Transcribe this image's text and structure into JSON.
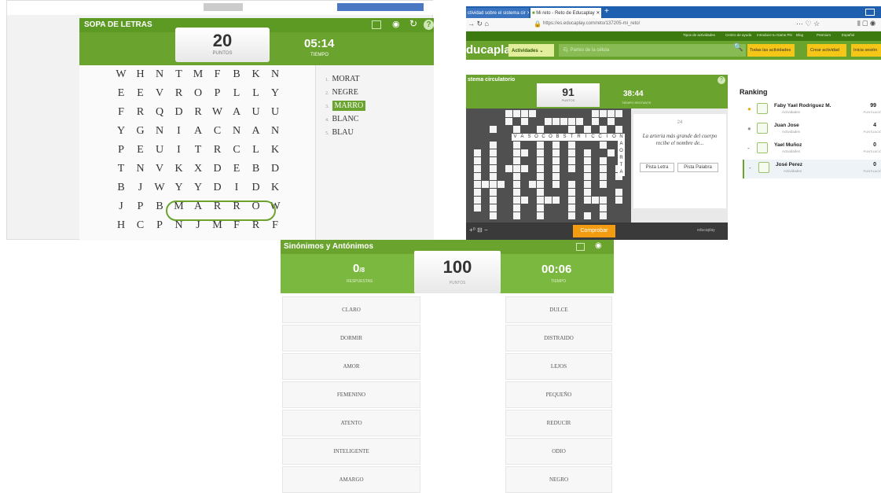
{
  "left": {
    "title": "SOPA DE LETRAS",
    "score": "20",
    "score_label": "PUNTOS",
    "time": "05:14",
    "time_label": "TIEMPO",
    "grid": [
      [
        "W",
        "H",
        "N",
        "T",
        "M",
        "F",
        "B",
        "K",
        "N"
      ],
      [
        "E",
        "E",
        "V",
        "R",
        "O",
        "P",
        "L",
        "L",
        "Y"
      ],
      [
        "F",
        "R",
        "Q",
        "D",
        "R",
        "W",
        "A",
        "U",
        "U"
      ],
      [
        "Y",
        "G",
        "N",
        "I",
        "A",
        "C",
        "N",
        "A",
        "N"
      ],
      [
        "P",
        "E",
        "U",
        "I",
        "T",
        "R",
        "C",
        "L",
        "K"
      ],
      [
        "T",
        "N",
        "V",
        "K",
        "X",
        "D",
        "E",
        "B",
        "D"
      ],
      [
        "B",
        "J",
        "W",
        "Y",
        "Y",
        "D",
        "I",
        "D",
        "K"
      ],
      [
        "J",
        "P",
        "B",
        "M",
        "A",
        "R",
        "R",
        "O",
        "W"
      ],
      [
        "H",
        "C",
        "P",
        "N",
        "J",
        "M",
        "F",
        "R",
        "F"
      ]
    ],
    "words": [
      {
        "num": "1.",
        "text": "MORAT"
      },
      {
        "num": "2.",
        "text": "NEGRE"
      },
      {
        "num": "3.",
        "text": "MARRO"
      },
      {
        "num": "4.",
        "text": "BLANC"
      },
      {
        "num": "5.",
        "text": "BLAU"
      }
    ]
  },
  "right": {
    "tabs": [
      "ctividad sobre el sistema cir",
      "Mi reto - Reto de Educaplay"
    ],
    "url": "https://es.educaplay.com/reto/137205-mi_reto/",
    "topnav": [
      "Tipos de actividades",
      "Centro de ayuda",
      "Introduce tu Game Pin",
      "Blog",
      "Premium",
      "Español"
    ],
    "logo": "ducaplay",
    "activities_label": "Actividades",
    "search_placeholder": "Ej. Partes de la célula",
    "all_activities": "Todas las actividades",
    "create": "Crear actividad",
    "login": "Inicia sesión",
    "game_title": "stema circulatorio",
    "score": "91",
    "score_label": "PUNTOS",
    "time": "38:44",
    "time_label": "TIEMPO RESTANTE",
    "clue_num": "24",
    "clue": "La arteria más grande del cuerpo recibe el nombre de...",
    "hint_letter": "Pista Letra",
    "hint_word": "Pista Palabra",
    "check": "Comprobar",
    "brand_small": "educaplay",
    "cross_word": [
      "V",
      "A",
      "S",
      "O",
      "C",
      "O",
      "B",
      "S",
      "T",
      "R",
      "I",
      "C",
      "C",
      "I",
      "O",
      "N"
    ],
    "cross_vert": [
      "A",
      "O",
      "R",
      "T",
      "A"
    ],
    "ranking_title": "Ranking",
    "ranking": [
      {
        "name": "Faby Yael Rodriguez M.",
        "sub": "Actividades",
        "score": "99",
        "score_label": "PUNTUACIÓN"
      },
      {
        "name": "Juan Jose",
        "sub": "Actividades",
        "score": "4",
        "score_label": "PUNTUACIÓN"
      },
      {
        "name": "Yael Muñoz",
        "sub": "Actividades",
        "score": "0",
        "score_label": "PUNTUACIÓN"
      },
      {
        "name": "José Perez",
        "sub": "Actividades",
        "score": "0",
        "score_label": "PUNTUACIÓN"
      }
    ]
  },
  "bottom": {
    "title": "Sinónimos y Antónimos",
    "hits": "0",
    "hits_sup": "/8",
    "hits_label": "RESPUESTAS",
    "score": "100",
    "score_label": "PUNTOS",
    "time": "00:06",
    "time_label": "TIEMPO",
    "left": [
      "CLARO",
      "DORMIR",
      "AMOR",
      "FEMENINO",
      "ATENTO",
      "INTELIGENTE",
      "AMARGO"
    ],
    "right": [
      "DULCE",
      "DISTRAIDO",
      "LEJOS",
      "PEQUEÑO",
      "REDUCIR",
      "ODIO",
      "NEGRO"
    ]
  },
  "colors": {
    "green": "#6aa42f",
    "light_green": "#7bb83f",
    "orange": "#f39c12",
    "yellow": "#f5c518"
  }
}
